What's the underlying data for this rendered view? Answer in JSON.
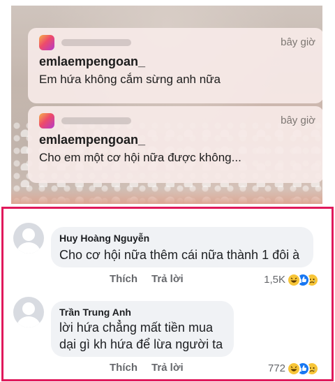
{
  "notifications": [
    {
      "time": "bây giờ",
      "sender": "emlaempengoan_",
      "message": "Em hứa không cắm sừng anh nữa"
    },
    {
      "time": "bây giờ",
      "sender": "emlaempengoan_",
      "message": "Cho em một cơ hội nữa được không..."
    }
  ],
  "comments": [
    {
      "author": "Huy Hoàng Nguyễn",
      "lines": [
        "Cho cơ hội nữa thêm cái nữa thành 1 đôi à"
      ],
      "like_label": "Thích",
      "reply_label": "Trả lời",
      "reaction_count": "1,5K",
      "reactions": [
        "haha-icon",
        "like-icon",
        "sad-icon"
      ]
    },
    {
      "author": "Trần Trung Anh",
      "lines": [
        "lời hứa chẳng mất tiền mua",
        "dại gì kh hứa để lừa người ta"
      ],
      "like_label": "Thích",
      "reply_label": "Trả lời",
      "reaction_count": "772",
      "reactions": [
        "haha-icon",
        "like-icon",
        "sad-icon"
      ]
    }
  ],
  "colors": {
    "frame_border": "#e0195b",
    "bubble": "#f0f2f5",
    "like": "#1877f2",
    "emoji": "#f7c538"
  }
}
